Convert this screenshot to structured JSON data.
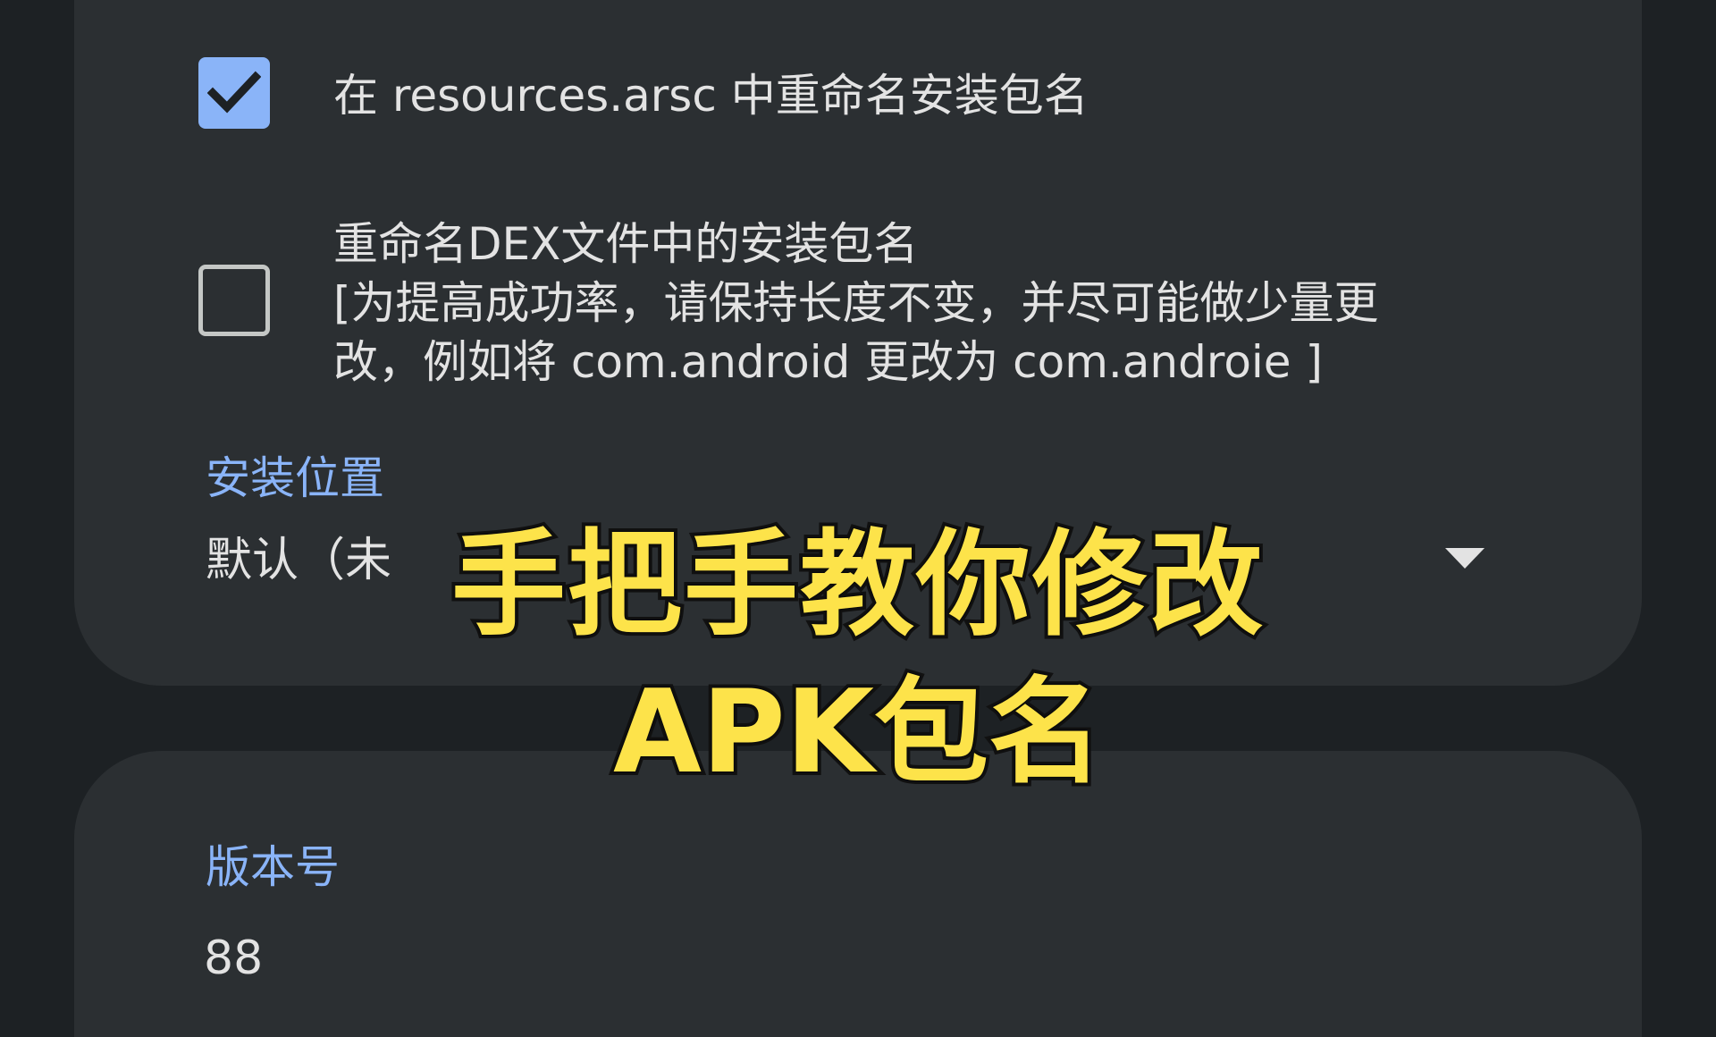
{
  "options": {
    "rename_resources": {
      "label": "在 resources.arsc 中重命名安装包名",
      "checked": true
    },
    "rename_dex": {
      "label_line1": "重命名DEX文件中的安装包名",
      "label_line2": "[为提高成功率，请保持长度不变，并尽可能做少量更",
      "label_line3": "改，例如将 com.android 更改为 com.androie ]",
      "checked": false
    }
  },
  "install_location": {
    "label": "安装位置",
    "value": "默认（未"
  },
  "version": {
    "label": "版本号",
    "value": "88"
  },
  "overlay": {
    "line1": "手把手教你修改",
    "line2": "APK包名"
  },
  "colors": {
    "background": "#1d2124",
    "card": "#2b2f32",
    "accent": "#8ab4f8",
    "text": "#e3e3e3",
    "overlay_text": "#fde34a"
  },
  "icons": [
    "checkmark-icon",
    "dropdown-arrow-icon"
  ]
}
